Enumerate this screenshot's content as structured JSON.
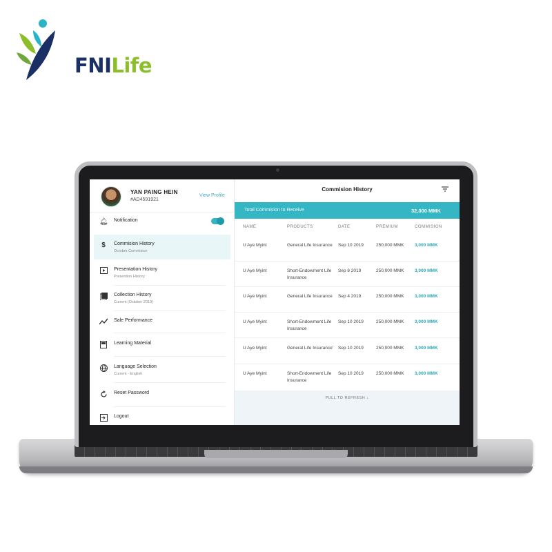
{
  "brand": {
    "logo_fni": "FNI",
    "logo_life": "Life"
  },
  "profile": {
    "name": "YAN PAING HEIN",
    "id": "#AD4591921",
    "view_profile": "View Profile"
  },
  "sidebar": {
    "items": [
      {
        "label": "Notification",
        "sub": "",
        "icon": "bell-icon"
      },
      {
        "label": "Commision History",
        "sub": "October Commision",
        "icon": "dollar-icon"
      },
      {
        "label": "Presentation History",
        "sub": "Presention History",
        "icon": "presentation-icon"
      },
      {
        "label": "Collection History",
        "sub": "Current (October 2019)",
        "icon": "gallery-icon"
      },
      {
        "label": "Sale Performance",
        "sub": "",
        "icon": "trend-icon"
      },
      {
        "label": "Learning Material",
        "sub": "",
        "icon": "book-icon"
      },
      {
        "label": "Language Selection",
        "sub": "Current - English",
        "icon": "globe-icon"
      },
      {
        "label": "Reset Password",
        "sub": "",
        "icon": "reset-icon"
      },
      {
        "label": "Logout",
        "sub": "",
        "icon": "logout-icon"
      }
    ]
  },
  "main": {
    "title": "Commision History",
    "banner_label": "Total Commision to Receive",
    "banner_value": "32,000 MMK",
    "columns": [
      "NAME",
      "PRODUCTS",
      "DATE",
      "PREMIUM",
      "COMMISION"
    ],
    "rows": [
      {
        "name": "U Aye Myint",
        "product": "General Life Insurance",
        "date": "Sep 10 2019",
        "premium": "250,000 MMK",
        "commision": "3,000 MMK"
      },
      {
        "name": "U Aye Myint",
        "product": "Short-Endowment Life Insurance",
        "date": "Sep 6 2019",
        "premium": "250,000 MMK",
        "commision": "3,000 MMK"
      },
      {
        "name": "U Aye Myint",
        "product": "General Life Insurance",
        "date": "Sep 4 2019",
        "premium": "250,000 MMK",
        "commision": "3,000 MMK"
      },
      {
        "name": "U Aye Myint",
        "product": "Short-Endowment Life Insurance",
        "date": "Sep 10 2019",
        "premium": "250,000 MMK",
        "commision": "3,000 MMK"
      },
      {
        "name": "U Aye Myint",
        "product": "General Life Insurance'",
        "date": "Sep 10 2019",
        "premium": "250,000 MMK",
        "commision": "3,000 MMK"
      },
      {
        "name": "U Aye Myint",
        "product": "Short-Endowment Life Insurance",
        "date": "Sep 10 2019",
        "premium": "250,000 MMK",
        "commision": "3,000 MMK"
      }
    ],
    "pull_to_refresh": "PULL TO REFRESH ↓"
  },
  "colors": {
    "accent": "#34b6c4",
    "brand_navy": "#1a2f63",
    "brand_green": "#8cbe2b"
  }
}
